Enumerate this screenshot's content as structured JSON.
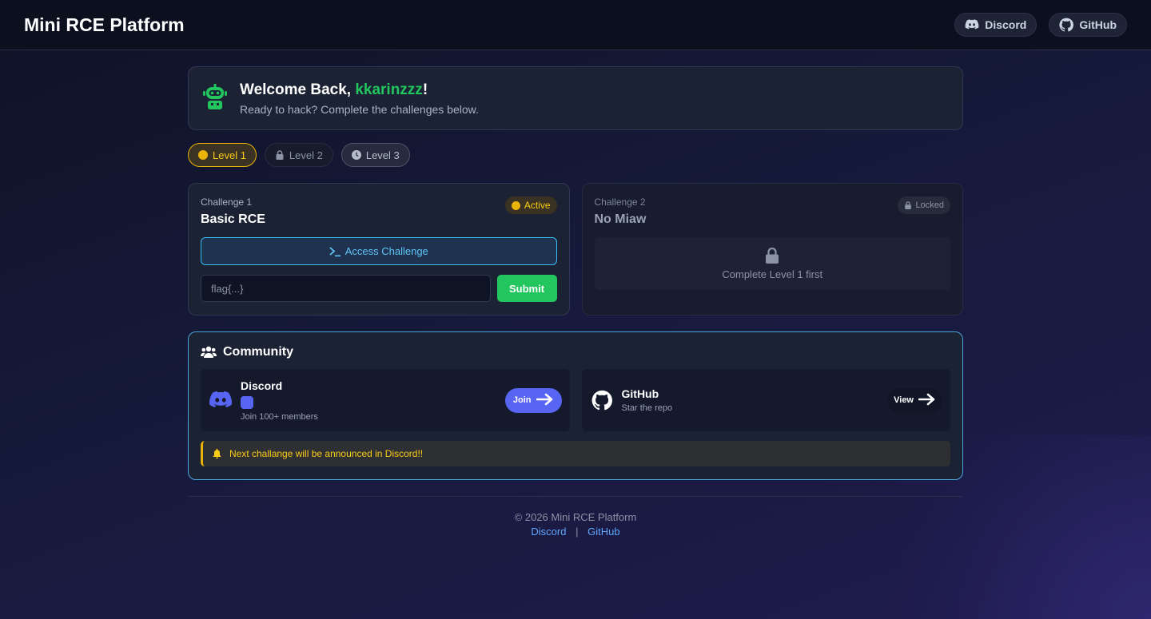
{
  "header": {
    "brand": "Mini RCE Platform",
    "discord_label": "Discord",
    "github_label": "GitHub"
  },
  "welcome": {
    "prefix": "Welcome Back, ",
    "username": "kkarinzzz",
    "suffix": "!",
    "subtitle": "Ready to hack? Complete the challenges below."
  },
  "levels": [
    {
      "label": "Level 1",
      "state": "active"
    },
    {
      "label": "Level 2",
      "state": "locked"
    },
    {
      "label": "Level 3",
      "state": "upcoming"
    }
  ],
  "challenges": [
    {
      "label": "Challenge 1",
      "title": "Basic RCE",
      "badge": "Active",
      "access_label": "Access Challenge",
      "flag_placeholder": "flag{...}",
      "submit_label": "Submit"
    },
    {
      "label": "Challenge 2",
      "title": "No Miaw",
      "badge": "Locked",
      "locked_text": "Complete Level 1 first"
    }
  ],
  "community": {
    "title": "Community",
    "discord": {
      "name": "Discord",
      "sub": "Join 100+ members",
      "button": "Join"
    },
    "github": {
      "name": "GitHub",
      "sub": "Star the repo",
      "button": "View"
    },
    "notice": "Next challange will be announced in Discord!!"
  },
  "footer": {
    "copyright": "© 2026 Mini RCE Platform",
    "discord_link": "Discord",
    "separator": "|",
    "github_link": "GitHub"
  },
  "colors": {
    "accent_green": "#22c55e",
    "accent_yellow": "#eab308",
    "accent_cyan": "#38bdf8",
    "discord_blurple": "#5865f2"
  }
}
